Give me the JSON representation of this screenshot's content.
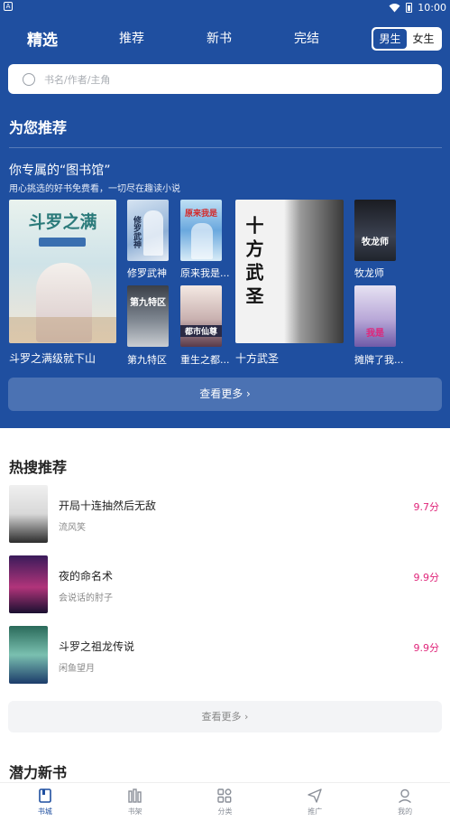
{
  "status": {
    "time": "10:00"
  },
  "tabs": [
    {
      "label": "精选",
      "active": true
    },
    {
      "label": "推荐",
      "active": false
    },
    {
      "label": "新书",
      "active": false
    },
    {
      "label": "完结",
      "active": false
    }
  ],
  "gender": {
    "male": "男生",
    "female": "女生",
    "selected": "male"
  },
  "search": {
    "placeholder": "书名/作者/主角"
  },
  "recommend": {
    "title": "为您推荐",
    "library_title": "你专属的“图书馆”",
    "library_subtitle": "用心挑选的好书免费看，一切尽在趣读小说",
    "featured": [
      {
        "title": "斗罗之满级就下山",
        "cover_text": "斗罗之满"
      },
      {
        "title": "十方武圣",
        "cover_text": "十方武圣"
      }
    ],
    "small": [
      {
        "title": "修罗武神",
        "cover_text": "修罗武神"
      },
      {
        "title": "原来我是...",
        "cover_text": "原来我是"
      },
      {
        "title": "第九特区",
        "cover_text": "第九特区"
      },
      {
        "title": "重生之都...",
        "cover_text": "都市仙尊"
      },
      {
        "title": "牧龙师",
        "cover_text": "牧龙师"
      },
      {
        "title": "摊牌了我...",
        "cover_text": "我是"
      }
    ],
    "more_label": "查看更多 ›"
  },
  "hot": {
    "title": "热搜推荐",
    "items": [
      {
        "name": "开局十连抽然后无敌",
        "author": "流风笑",
        "score": "9.7分"
      },
      {
        "name": "夜的命名术",
        "author": "会说话的肘子",
        "score": "9.9分"
      },
      {
        "name": "斗罗之祖龙传说",
        "author": "闲鱼望月",
        "score": "9.9分"
      }
    ],
    "more_label": "查看更多 ›"
  },
  "potential": {
    "title": "潜力新书"
  },
  "bottom_nav": [
    {
      "label": "书城",
      "icon": "book-icon",
      "active": true
    },
    {
      "label": "书架",
      "icon": "shelf-icon",
      "active": false
    },
    {
      "label": "分类",
      "icon": "category-icon",
      "active": false
    },
    {
      "label": "推广",
      "icon": "send-icon",
      "active": false
    },
    {
      "label": "我的",
      "icon": "user-icon",
      "active": false
    }
  ],
  "colors": {
    "primary": "#1f4fa0",
    "score": "#e0267a"
  }
}
